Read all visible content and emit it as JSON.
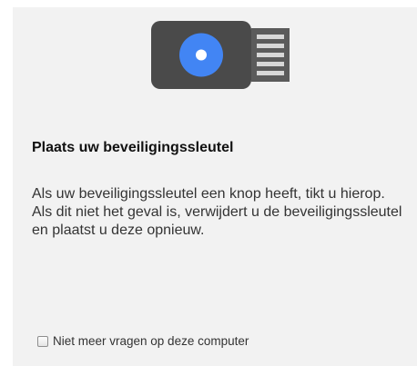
{
  "dialog": {
    "illustration_icon": "usb-security-key-icon",
    "title": "Plaats uw beveiligingssleutel",
    "message_lines": [
      "Als uw beveiligingssleutel een knop heeft, tikt u hierop.",
      "Als dit niet het geval is, verwijdert u de beveiligingssleutel en plaatst u deze opnieuw."
    ],
    "remember_checkbox": {
      "label": "Niet meer vragen op deze computer",
      "checked": false
    }
  },
  "colors": {
    "panel_background": "#f2f2f2",
    "key_body": "#4a4a4a",
    "key_button": "#4285f4",
    "key_connector": "#5b5b5b"
  }
}
